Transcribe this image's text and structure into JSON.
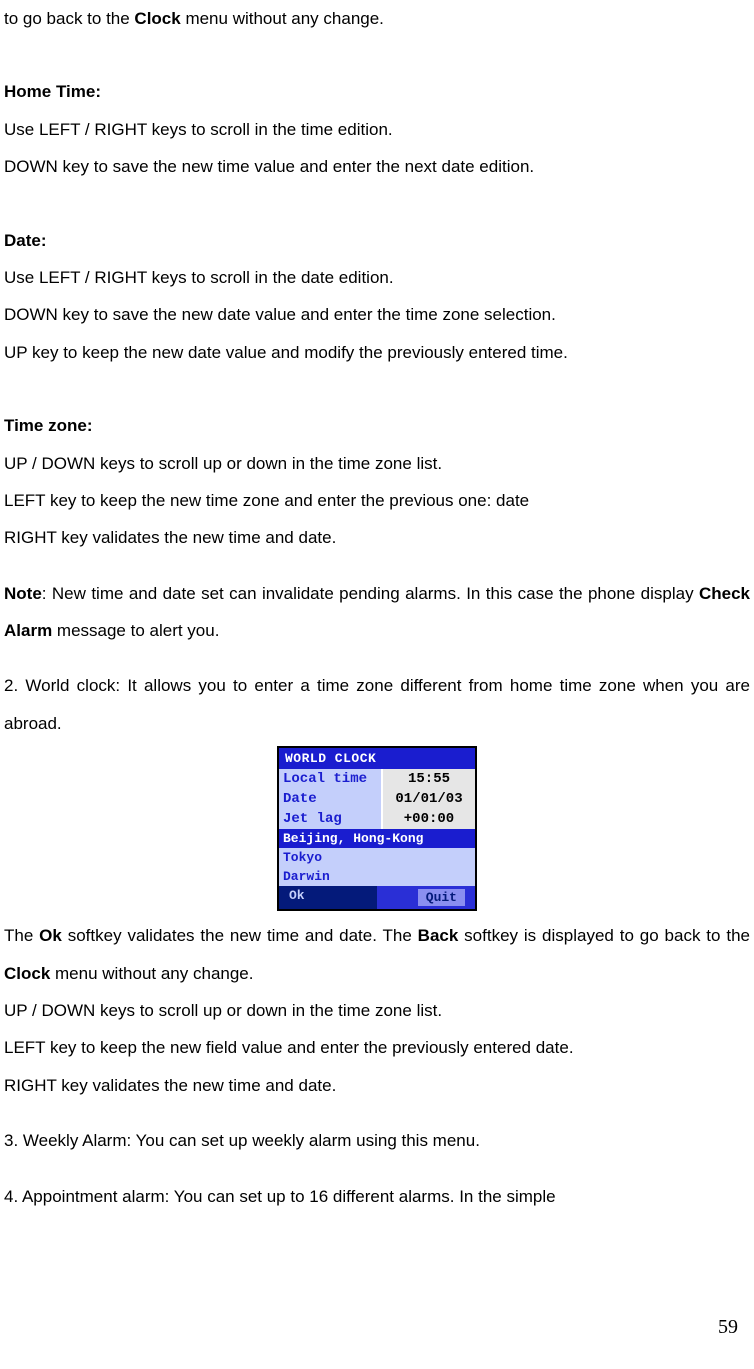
{
  "doc": {
    "top_line_pre": "to go back to the ",
    "top_line_bold": "Clock",
    "top_line_post": " menu without any change.",
    "home_time_heading": "Home Time:",
    "home_time_l1": "Use LEFT / RIGHT keys to scroll in the time edition.",
    "home_time_l2": "DOWN key to save the new time value and enter the next date edition.",
    "date_heading": "Date:",
    "date_l1": "Use LEFT / RIGHT keys to scroll in the date edition.",
    "date_l2": "DOWN key to save the new date value and enter the time zone selection.",
    "date_l3": "UP key to keep the new date value and modify the previously entered time.",
    "tz_heading": "Time zone:",
    "tz_l1": "UP / DOWN keys to scroll up or down in the time zone list.",
    "tz_l2": "LEFT key to keep the new time zone and enter the previous one: date",
    "tz_l3": "RIGHT key validates the new time and date.",
    "note_label": "Note",
    "note_sep": ":   ",
    "note_body_pre": "New time and date set can invalidate pending alarms. In this case the phone display ",
    "note_body_bold": "Check Alarm",
    "note_body_post": " message to alert you.",
    "world_clock_intro": "2. World clock: It allows you to enter a time zone different from home time zone when you are abroad.",
    "after_phone_p1_pre": "The ",
    "after_phone_p1_b1": "Ok",
    "after_phone_p1_mid1": " softkey validates the new time and date. The ",
    "after_phone_p1_b2": "Back",
    "after_phone_p1_mid2": " softkey is displayed to go back to the ",
    "after_phone_p1_b3": "Clock",
    "after_phone_p1_post": " menu without any change.",
    "after_phone_l2": "UP / DOWN keys to scroll up or down in the time zone list.",
    "after_phone_l3": "LEFT key to keep the new field value and enter the previously entered date.",
    "after_phone_l4": "RIGHT key validates the new time and date.",
    "weekly": "3. Weekly Alarm: You can set up weekly alarm using this menu.",
    "appointment": "4. Appointment alarm: You can set up to 16 different alarms. In the simple",
    "page_number": "59"
  },
  "phone": {
    "title": "WORLD CLOCK",
    "rows": [
      {
        "label": "Local time",
        "value": "15:55"
      },
      {
        "label": "Date",
        "value": "01/01/03"
      },
      {
        "label": "Jet lag",
        "value": "+00:00"
      }
    ],
    "list": [
      "Beijing, Hong-Kong",
      "Tokyo",
      "Darwin"
    ],
    "softkeys": {
      "left": "Ok",
      "right": "Quit"
    }
  }
}
